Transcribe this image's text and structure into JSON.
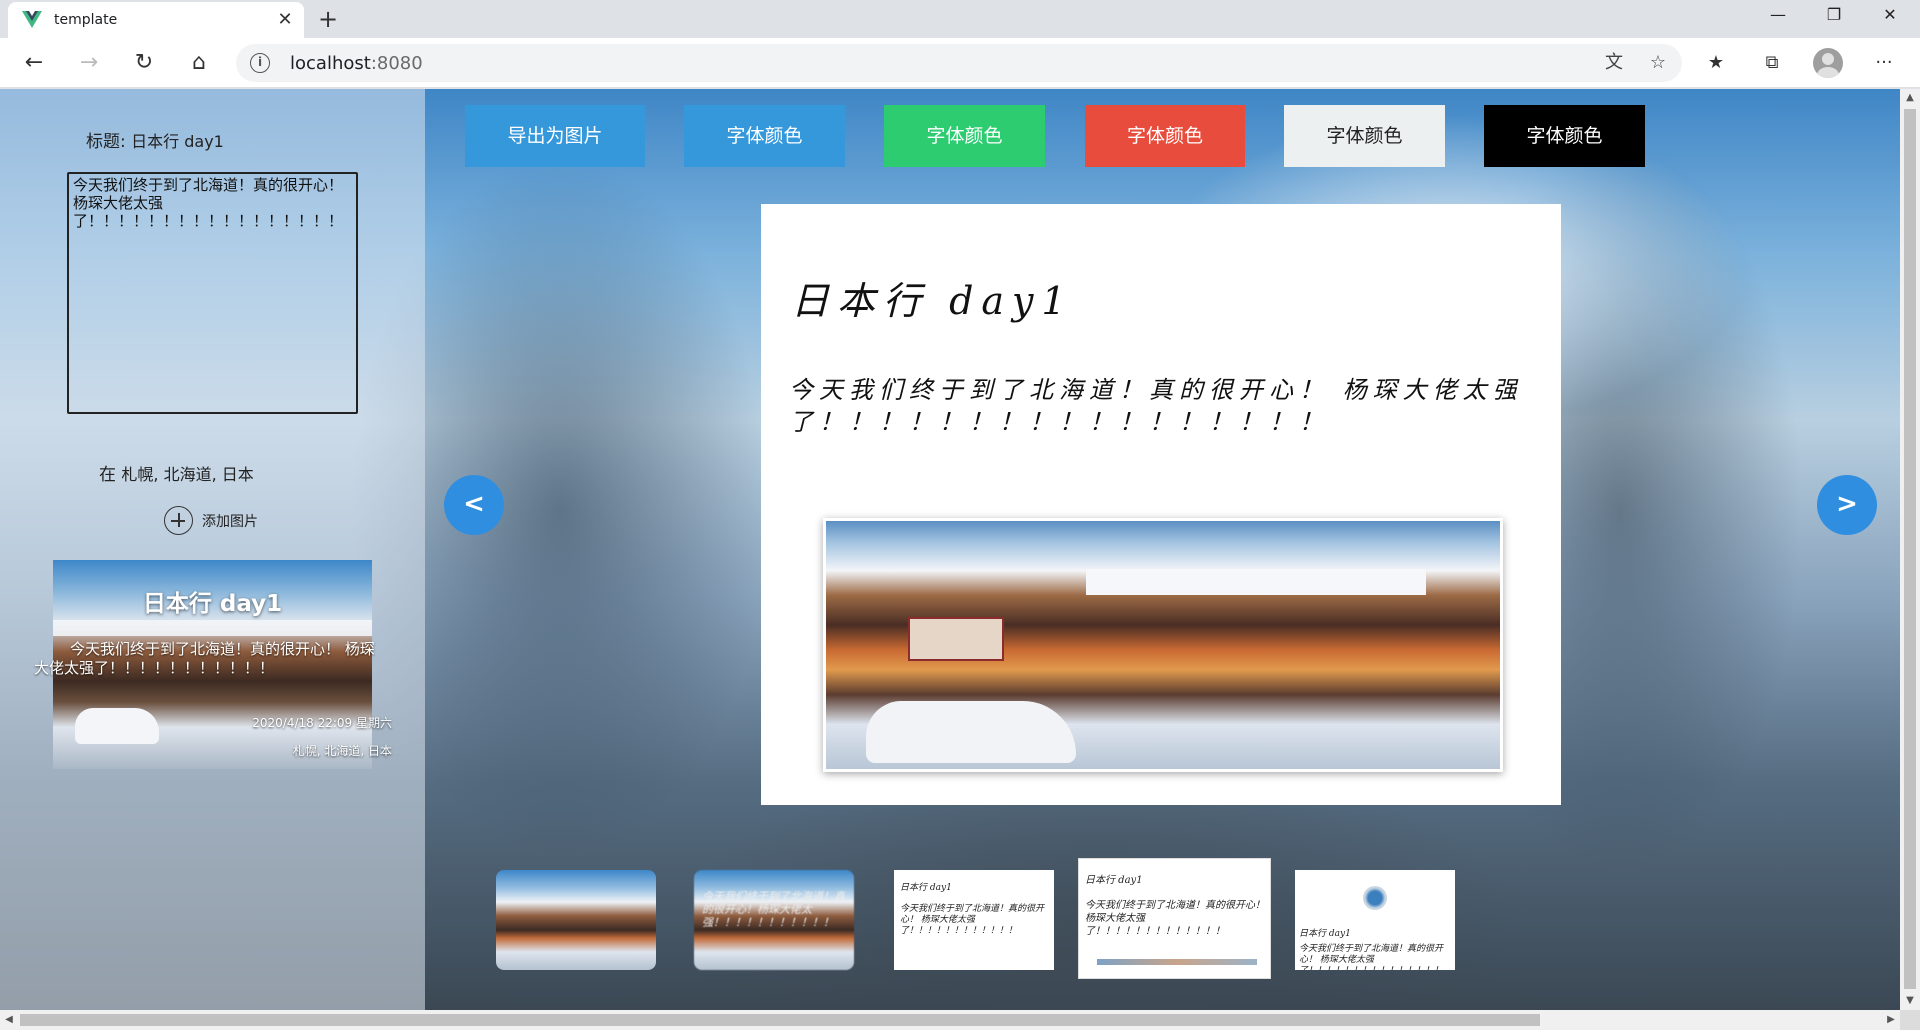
{
  "browser": {
    "tab_title": "template",
    "tab_close": "✕",
    "new_tab": "+",
    "url_host": "localhost",
    "url_port": ":8080",
    "window_buttons": [
      "—",
      "❐",
      "✕"
    ]
  },
  "toolbar": {
    "back": "←",
    "forward": "→",
    "reload": "↻",
    "home": "⌂",
    "info": "i",
    "translate": "文",
    "star": "☆",
    "favorites": "★",
    "collections": "⧉",
    "more": "···"
  },
  "sidebar": {
    "title_label": "标题:",
    "title_value": "日本行 day1",
    "content_value": "今天我们终于到了北海道！真的很开心！\n杨琛大佬太强了！！！！！！！！！！！！！！！！！",
    "location_label": "在",
    "location_value": "札幌, 北海道, 日本",
    "add_image_label": "添加图片"
  },
  "preview": {
    "title": "日本行 day1",
    "body": "今天我们终于到了北海道！真的很开心！ 杨琛大佬太强了！！！！！！！！！！！",
    "datetime": "2020/4/18 22:09 星期六",
    "location": "札幌, 北海道, 日本"
  },
  "actions": {
    "export": "导出为图片",
    "color_blue": "字体颜色",
    "color_green": "字体颜色",
    "color_red": "字体颜色",
    "color_white": "字体颜色",
    "color_black": "字体颜色"
  },
  "colors": {
    "export_bg": "#3498db",
    "blue": "#3498db",
    "green": "#2ecc71",
    "red": "#e74c3c",
    "white": "#ecf0f1",
    "black": "#000000",
    "nav": "#2f8ee0"
  },
  "card": {
    "title": "日本行 day1",
    "body": "今天我们终于到了北海道！真的很开心！ 杨琛大佬太强了！！！！！！！！！！！！！！！！！"
  },
  "nav": {
    "prev": "<",
    "next": ">"
  },
  "thumbnails": {
    "t2_text": "今天我们终于到了北海道！真的很开心！杨琛大佬太强！！！！！！！！！！！",
    "t3_title": "日本行 day1",
    "t3_body": "今天我们终于到了北海道！真的很开心！ 杨琛大佬太强了！！！！！！！！！！！！",
    "t4_title": "日本行 day1",
    "t4_body": "今天我们终于到了北海道！真的很开心！ 杨琛大佬太强了！！！！！！！！！！！！！",
    "t5_title": "日本行 day1",
    "t5_body": "今天我们终于到了北海道！真的很开心！ 杨琛大佬太强了！！！！！！！！！！！！！！！"
  },
  "scrollbars": {
    "up": "▲",
    "down": "▼",
    "left": "◀",
    "right": "▶"
  }
}
